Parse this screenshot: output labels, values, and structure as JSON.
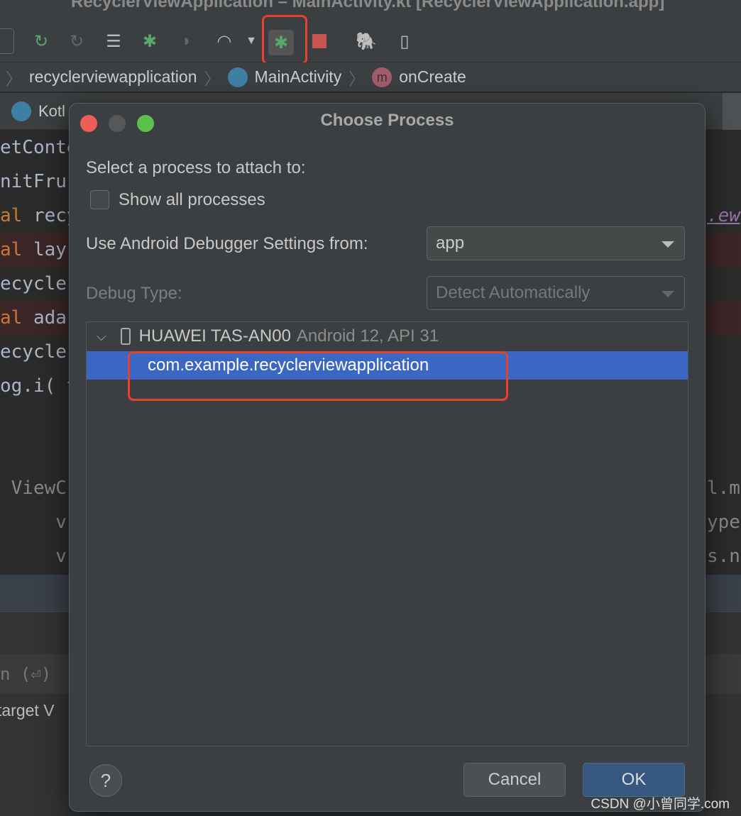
{
  "window_title": "RecyclerViewApplication – MainActivity.kt [RecyclerViewApplication.app]",
  "breadcrumb": [
    "recyclerviewapplication",
    "MainActivity",
    "onCreate"
  ],
  "tabs": [
    "Kotl"
  ],
  "code_lines": [
    {
      "pre": "",
      "kw": "",
      "rest": "etConte"
    },
    {
      "pre": "",
      "kw": "",
      "rest": "nitFru"
    },
    {
      "pre": "",
      "kw": "al",
      "rest": " recy"
    },
    {
      "pre": "",
      "kw": "al",
      "rest": " lay"
    },
    {
      "pre": "",
      "kw": "",
      "rest": "ecycle"
    },
    {
      "pre": "",
      "kw": "al",
      "rest": " ada"
    },
    {
      "pre": "",
      "kw": "",
      "rest": "ecycle"
    },
    {
      "pre": "",
      "kw": "",
      "rest": "og.i( t"
    },
    {
      "pre": "",
      "kw": "",
      "rest": ""
    },
    {
      "pre": "",
      "kw": "",
      "rest": ""
    },
    {
      "pre": "",
      "kw": "",
      "rest": " ViewC"
    },
    {
      "pre": "",
      "kw": "",
      "rest": "     v"
    },
    {
      "pre": "",
      "kw": "",
      "rest": "     v"
    }
  ],
  "code_right": {
    "line3": ".ew)",
    "line11": "l.ma",
    "line12": "ype.",
    "line13": "s.n"
  },
  "lower_text1": "n (⏎)",
  "lower_text2": "target V",
  "dialog": {
    "title": "Choose Process",
    "prompt": "Select a process to attach to:",
    "show_all_label": "Show all processes",
    "show_all_checked": false,
    "settings_label": "Use Android Debugger Settings from:",
    "settings_value": "app",
    "debug_type_label": "Debug Type:",
    "debug_type_value": "Detect Automatically",
    "device_name": "HUAWEI TAS-AN00",
    "device_info": "Android 12, API 31",
    "process": "com.example.recyclerviewapplication",
    "help": "?",
    "cancel": "Cancel",
    "ok": "OK"
  },
  "watermark": "CSDN @小曾同学.com",
  "colors": {
    "selection": "#3a66c4",
    "highlight": "#e8412c",
    "ok_button": "#365880"
  }
}
